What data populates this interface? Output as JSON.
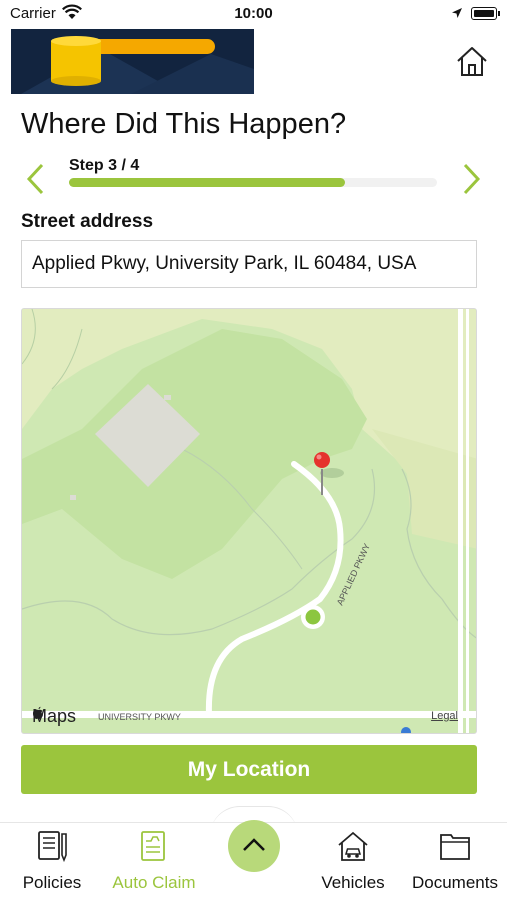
{
  "status_bar": {
    "carrier": "Carrier",
    "time": "10:00"
  },
  "header": {
    "home_icon": "home-icon"
  },
  "page": {
    "title": "Where Did This Happen?"
  },
  "stepper": {
    "label": "Step 3 / 4",
    "progress": 0.75,
    "prev_icon": "chevron-left-icon",
    "next_icon": "chevron-right-icon"
  },
  "address": {
    "label": "Street address",
    "value": "Applied Pkwy, University Park, IL 60484, USA"
  },
  "map": {
    "brand": "Maps",
    "legal": "Legal",
    "road_labels": [
      "APPLIED PKWY",
      "UNIVERSITY PKWY"
    ],
    "pin_color": "#e5322d",
    "user_dot_color": "#8cc63f"
  },
  "actions": {
    "my_location": "My Location"
  },
  "tab_bar": {
    "items": [
      {
        "label": "Policies",
        "icon": "policies-icon"
      },
      {
        "label": "Auto Claim",
        "icon": "auto-claim-icon"
      },
      {
        "label": "Vehicles",
        "icon": "vehicles-icon"
      },
      {
        "label": "Documents",
        "icon": "documents-icon"
      }
    ],
    "center_icon": "chevron-up-icon"
  },
  "colors": {
    "accent": "#9bc53d",
    "logo_bg": "#12243f",
    "logo_yellow": "#f5c400"
  }
}
